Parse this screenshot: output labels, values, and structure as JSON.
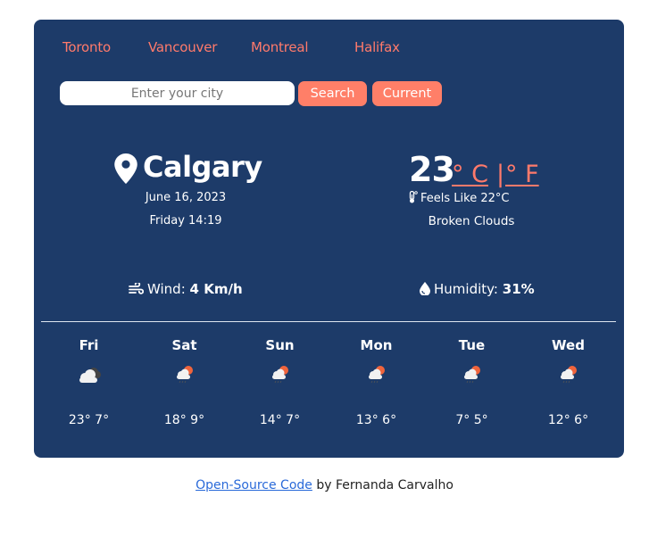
{
  "colors": {
    "card_bg": "#1d3b69",
    "accent": "#ff7a6b",
    "button_bg": "#ff7f68",
    "link": "#2a6ad9"
  },
  "cities": [
    {
      "label": "Toronto"
    },
    {
      "label": "Vancouver"
    },
    {
      "label": "Montreal"
    },
    {
      "label": "Halifax"
    }
  ],
  "search": {
    "value": "",
    "placeholder": "Enter your city",
    "search_label": "Search",
    "current_label": "Current"
  },
  "current": {
    "location_icon": "map-pin-icon",
    "city": "Calgary",
    "date": "June 16, 2023",
    "time": "Friday 14:19",
    "temperature": "23",
    "unit_celsius": "° C",
    "unit_separator": "|",
    "unit_fahrenheit": "° F",
    "feels_icon": "thermometer-icon",
    "feels_like": "Feels Like 22°C",
    "description": "Broken Clouds",
    "wind_icon": "wind-icon",
    "wind_label": "Wind:",
    "wind_value": "4 Km/h",
    "humidity_icon": "droplet-icon",
    "humidity_label": "Humidity:",
    "humidity_value": "31%"
  },
  "forecast": [
    {
      "day": "Fri",
      "icon": "broken-clouds-icon",
      "max": "23°",
      "min": "7°"
    },
    {
      "day": "Sat",
      "icon": "rain-sun-cloud-icon",
      "max": "18°",
      "min": "9°"
    },
    {
      "day": "Sun",
      "icon": "rain-sun-cloud-icon",
      "max": "14°",
      "min": "7°"
    },
    {
      "day": "Mon",
      "icon": "rain-sun-cloud-icon",
      "max": "13°",
      "min": "6°"
    },
    {
      "day": "Tue",
      "icon": "rain-sun-cloud-icon",
      "max": "7°",
      "min": "5°"
    },
    {
      "day": "Wed",
      "icon": "rain-sun-cloud-icon",
      "max": "12°",
      "min": "6°"
    }
  ],
  "footer": {
    "link_text": "Open-Source Code",
    "suffix": " by Fernanda Carvalho"
  }
}
